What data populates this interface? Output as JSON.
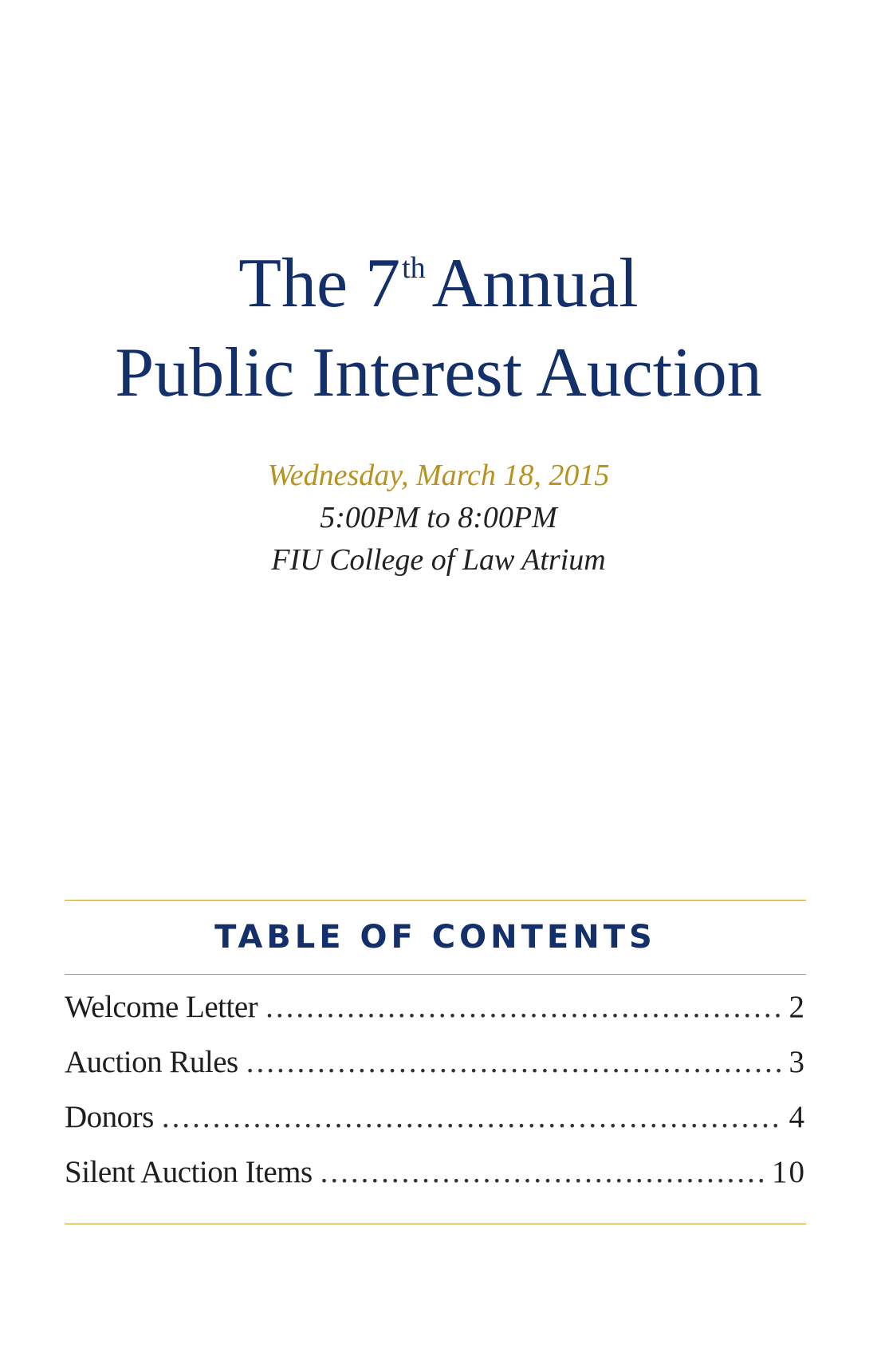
{
  "cover": {
    "title_line1_pre": "The 7",
    "title_line1_sup": "th",
    "title_line1_post": "Annual",
    "title_line2": "Public Interest Auction"
  },
  "event": {
    "date": "Wednesday, March 18, 2015",
    "time": "5:00PM to 8:00PM",
    "location": "FIU College of Law Atrium"
  },
  "toc": {
    "heading": "TABLE OF CONTENTS",
    "entries": [
      {
        "label": "Welcome Letter",
        "page": "2"
      },
      {
        "label": "Auction Rules",
        "page": "3"
      },
      {
        "label": "Donors",
        "page": "4"
      },
      {
        "label": "Silent Auction Items",
        "page": "10"
      }
    ]
  },
  "colors": {
    "title_navy": "#14306a",
    "date_gold": "#b8921f",
    "rule_gold": "#c69a2c"
  }
}
